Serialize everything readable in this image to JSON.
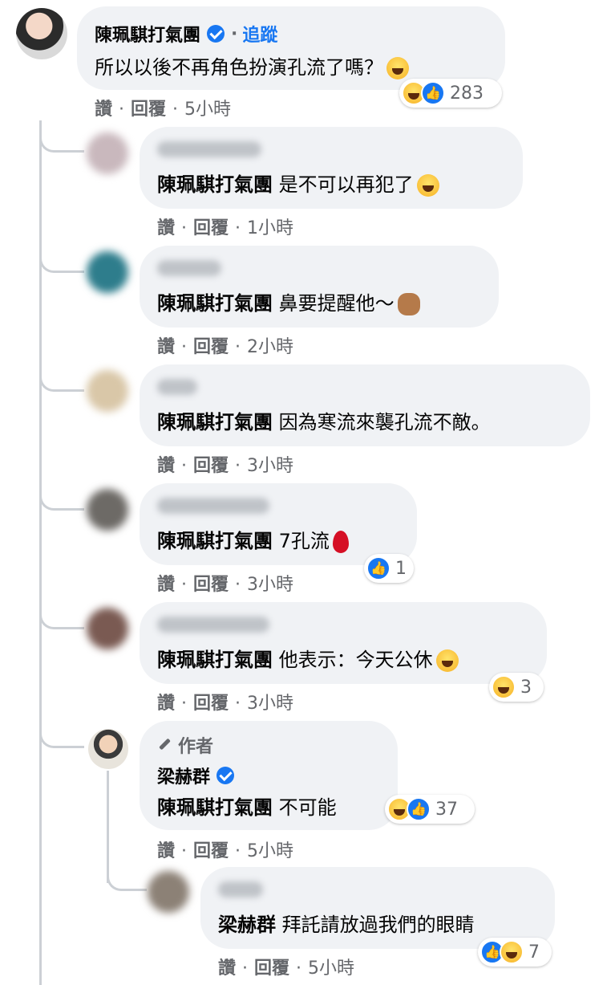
{
  "colors": {
    "accent": "#1877f2",
    "bubble": "#f0f2f5",
    "meta": "#65676b",
    "line": "#ccd0d5"
  },
  "main_comment": {
    "author": "陳珮騏打氣團",
    "follow": "追蹤",
    "text": "所以以後不再角色扮演孔流了嗎？",
    "emoji": "grinning-squint-emoji",
    "reaction_count": "283",
    "reaction_icons": [
      "haha-icon",
      "like-icon"
    ],
    "like": "讚",
    "reply": "回覆",
    "time": "5小時"
  },
  "replies": [
    {
      "mention": "陳珮騏打氣團",
      "text": "是不可以再犯了",
      "emoji": "rolling-laugh-emoji",
      "like": "讚",
      "reply": "回覆",
      "time": "1小時"
    },
    {
      "mention": "陳珮騏打氣團",
      "text": "鼻要提醒他～",
      "emoji": "see-no-evil-monkey-emoji",
      "like": "讚",
      "reply": "回覆",
      "time": "2小時"
    },
    {
      "mention": "陳珮騏打氣團",
      "text": "因為寒流來襲孔流不敵。",
      "like": "讚",
      "reply": "回覆",
      "time": "3小時"
    },
    {
      "mention": "陳珮騏打氣團",
      "text": "7孔流",
      "emoji": "drop-of-blood-emoji",
      "reaction_count": "1",
      "like": "讚",
      "reply": "回覆",
      "time": "3小時"
    },
    {
      "mention": "陳珮騏打氣團",
      "text": "他表示：今天公休",
      "emoji": "tears-of-joy-emoji",
      "reaction_count": "3",
      "like": "讚",
      "reply": "回覆",
      "time": "3小時"
    },
    {
      "author_badge": "作者",
      "author": "梁赫群",
      "mention": "陳珮騏打氣團",
      "text": "不可能",
      "reaction_count": "37",
      "like": "讚",
      "reply": "回覆",
      "time": "5小時"
    }
  ],
  "nested_reply": {
    "mention": "梁赫群",
    "text": "拜託請放過我們的眼睛",
    "reaction_count": "7",
    "like": "讚",
    "reply": "回覆",
    "time": "5小時"
  }
}
